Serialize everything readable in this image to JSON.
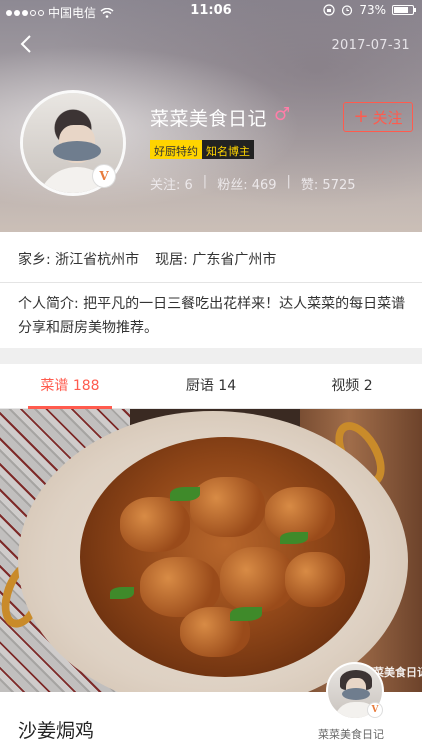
{
  "status_bar": {
    "carrier": "中国电信",
    "time": "11:06",
    "battery": "73%"
  },
  "header": {
    "date": "2017-07-31",
    "name": "菜菜美食日记",
    "gender_symbol": "♂",
    "follow_label": "关注",
    "badges": [
      "好厨特约",
      "知名博主"
    ],
    "verified_mark": "V",
    "stats": {
      "following": "关注: 6",
      "fans": "粉丝: 469",
      "likes": "赞: 5725",
      "separator": "|"
    }
  },
  "profile": {
    "hometown": "家乡: 浙江省杭州市",
    "residence": "现居: 广东省广州市",
    "bio": "个人简介: 把平凡的一日三餐吃出花样来！达人菜菜的每日菜谱分享和厨房美物推荐。"
  },
  "tabs": [
    {
      "label": "菜谱 188",
      "active": true
    },
    {
      "label": "厨语 14",
      "active": false
    },
    {
      "label": "视频 2",
      "active": false
    }
  ],
  "recipe": {
    "title": "沙姜焗鸡",
    "author": "菜菜美食日记",
    "watermark": "菜菜美食日记"
  },
  "colors": {
    "accent": "#ff5b4e",
    "badge_yellow": "#ffd400",
    "gender_pink": "#ff7ea8"
  }
}
